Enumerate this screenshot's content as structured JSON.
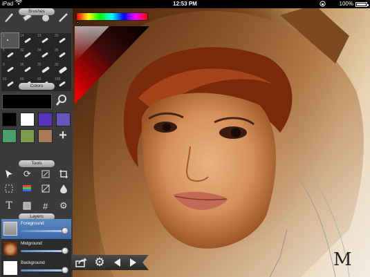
{
  "status_bar": {
    "carrier": "iPad",
    "time": "12:53 PM",
    "battery": "100%"
  },
  "panel": {
    "sections": {
      "brushes": "Brushes",
      "colors": "Colors",
      "tools": "Tools",
      "layers": "Layers"
    },
    "brush_sizes": [
      "1",
      "14",
      "19",
      "20",
      "5",
      "32",
      "34",
      "35",
      "9",
      "36",
      "35",
      "30",
      "50",
      "50",
      "60",
      "100"
    ],
    "swatches": [
      "#000000",
      "#ffffff",
      "#5533bb",
      "#6655bb",
      "#4aa06a",
      "#7f9a4a",
      "#a97a55"
    ],
    "layers": [
      {
        "name": "Foreground",
        "active": true
      },
      {
        "name": "Midground",
        "active": false
      },
      {
        "name": "Background",
        "active": false
      }
    ]
  },
  "canvas": {
    "signature": "M"
  },
  "colors": {
    "panel_bg": "#3b3b3b",
    "active_layer": "#4a76b0",
    "picker_red": "#ff0000"
  }
}
